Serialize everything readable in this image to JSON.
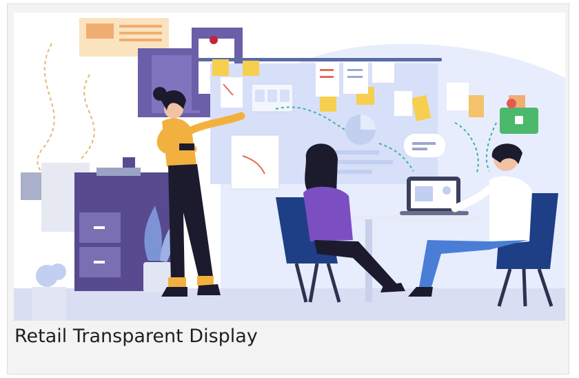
{
  "card": {
    "caption": "Retail Transparent Display"
  },
  "illustration": {
    "subject": "team-collaboration-board",
    "colors": {
      "board": "#e4ebfb",
      "navy": "#2b4a8e",
      "purple": "#6a5fa8",
      "yellow": "#f2c14e",
      "mustard": "#eba93a",
      "teal": "#37b3a3",
      "green": "#4cb86c",
      "floor": "#dfe3f5"
    }
  }
}
